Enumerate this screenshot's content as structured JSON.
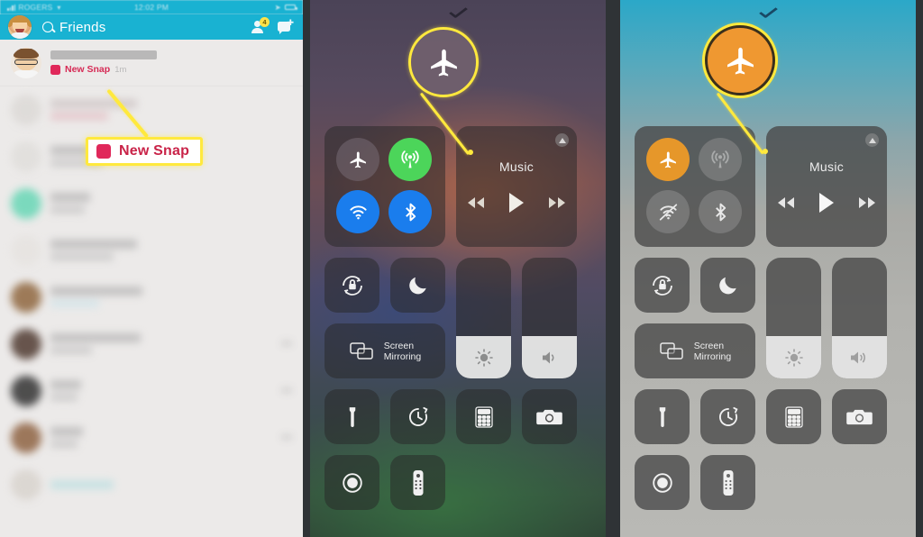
{
  "snapchat": {
    "status_bar": {
      "carrier": "ROGERS",
      "time": "12:02 PM"
    },
    "header": {
      "search_label": "Friends",
      "add_friend_badge": "4",
      "avatar_name": "bitmoji-avatar"
    },
    "rows": [
      {
        "new_snap_label": "New Snap",
        "time": "1m"
      }
    ],
    "annotation": {
      "label": "New Snap"
    }
  },
  "control_center_before": {
    "connectivity": {
      "airplane": {
        "label": "Airplane Mode",
        "state": "off",
        "color": "#786e76"
      },
      "cellular": {
        "label": "Cellular Data",
        "state": "on",
        "color": "#4cd55a"
      },
      "wifi": {
        "label": "Wi-Fi",
        "state": "on",
        "color": "#1a7ded"
      },
      "bluetooth": {
        "label": "Bluetooth",
        "state": "on",
        "color": "#1a7ded"
      }
    },
    "music": {
      "title": "Music",
      "airplay": "airplay-icon"
    },
    "tiles": {
      "rotation_lock": "Rotation Lock",
      "do_not_disturb": "Do Not Disturb",
      "screen_mirroring": "Screen Mirroring",
      "screen_mirroring_line1": "Screen",
      "screen_mirroring_line2": "Mirroring",
      "flashlight": "Flashlight",
      "timer": "Timer",
      "calculator": "Calculator",
      "camera": "Camera",
      "screen_record": "Screen Recording",
      "apple_tv_remote": "Apple TV Remote"
    },
    "sliders": {
      "brightness": 35,
      "volume": 35
    },
    "callout": {
      "icon": "airplane-icon",
      "highlight_color": "#ffe93d"
    }
  },
  "control_center_after": {
    "connectivity": {
      "airplane": {
        "label": "Airplane Mode",
        "state": "on",
        "color": "#e6972a"
      },
      "cellular": {
        "label": "Cellular Data",
        "state": "off",
        "color": "#8c8c8c"
      },
      "wifi": {
        "label": "Wi-Fi",
        "state": "off",
        "color": "#8c8c8c"
      },
      "bluetooth": {
        "label": "Bluetooth",
        "state": "off",
        "color": "#8c8c8c"
      }
    },
    "music": {
      "title": "Music",
      "airplay": "airplay-icon"
    },
    "tiles": {
      "rotation_lock": "Rotation Lock",
      "do_not_disturb": "Do Not Disturb",
      "screen_mirroring": "Screen Mirroring",
      "screen_mirroring_line1": "Screen",
      "screen_mirroring_line2": "Mirroring",
      "flashlight": "Flashlight",
      "timer": "Timer",
      "calculator": "Calculator",
      "camera": "Camera",
      "screen_record": "Screen Recording",
      "apple_tv_remote": "Apple TV Remote"
    },
    "sliders": {
      "brightness": 35,
      "volume": 35
    },
    "callout": {
      "icon": "airplane-icon",
      "highlight_color": "#ffe93d"
    }
  }
}
